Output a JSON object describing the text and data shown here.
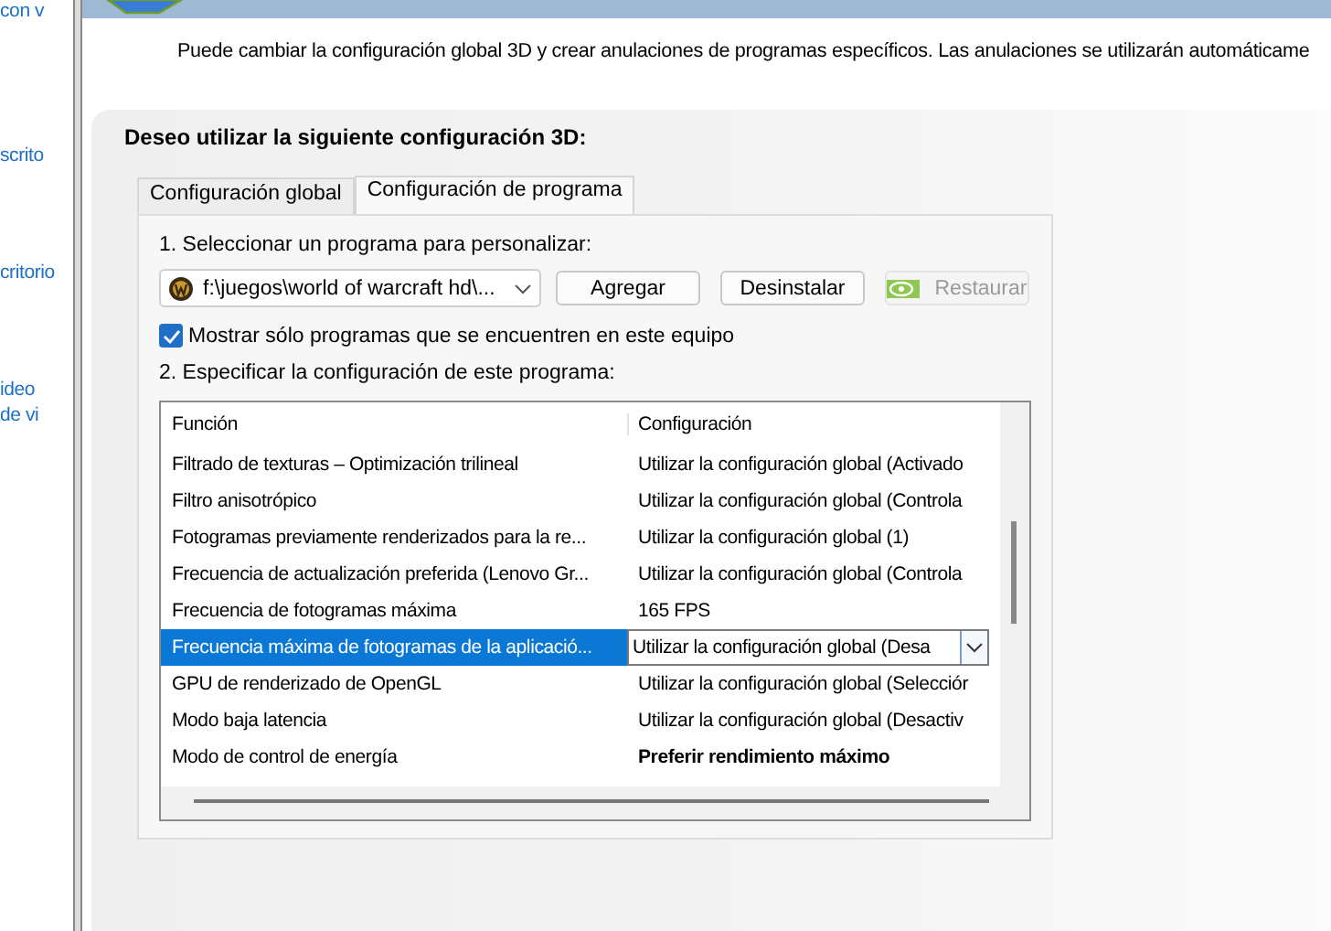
{
  "sidebar": {
    "items": [
      "con v",
      "scrito",
      "critorio",
      "ideo",
      "de vi"
    ]
  },
  "description": "Puede cambiar la configuración global 3D y crear anulaciones de programas específicos. Las anulaciones se utilizarán automáticame",
  "panel": {
    "title": "Deseo utilizar la siguiente configuración 3D:",
    "tabs": [
      {
        "label": "Configuración global",
        "selected": false
      },
      {
        "label": "Configuración de programa",
        "selected": true
      }
    ],
    "step1_label": "1. Seleccionar un programa para personalizar:",
    "program": {
      "value": "f:\\juegos\\world of warcraft hd\\..."
    },
    "buttons": [
      {
        "label": "Agregar",
        "disabled": false
      },
      {
        "label": "Desinstalar",
        "disabled": false
      },
      {
        "label": "Restaurar",
        "disabled": true
      }
    ],
    "show_only_installed": {
      "label": "Mostrar sólo programas que se encuentren en este equipo",
      "checked": true
    },
    "step2_label": "2. Especificar la configuración de este programa:",
    "table": {
      "columns": [
        "Función",
        "Configuración"
      ],
      "rows": [
        {
          "function": "Filtrado de texturas – Optimización trilineal",
          "setting": "Utilizar la configuración global (Activado",
          "selected": false,
          "bold": false
        },
        {
          "function": "Filtro anisotrópico",
          "setting": "Utilizar la configuración global (Controla",
          "selected": false,
          "bold": false
        },
        {
          "function": "Fotogramas previamente renderizados para la re...",
          "setting": "Utilizar la configuración global (1)",
          "selected": false,
          "bold": false
        },
        {
          "function": "Frecuencia de actualización preferida (Lenovo Gr...",
          "setting": "Utilizar la configuración global (Controla",
          "selected": false,
          "bold": false
        },
        {
          "function": "Frecuencia de fotogramas máxima",
          "setting": "165 FPS",
          "selected": false,
          "bold": false
        },
        {
          "function": "Frecuencia máxima de fotogramas de la aplicació...",
          "setting": "Utilizar la configuración global (Desa",
          "selected": true,
          "bold": false
        },
        {
          "function": "GPU de renderizado de OpenGL",
          "setting": "Utilizar la configuración global (Selecciór",
          "selected": false,
          "bold": false
        },
        {
          "function": "Modo baja latencia",
          "setting": "Utilizar la configuración global (Desactiv",
          "selected": false,
          "bold": false
        },
        {
          "function": "Modo de control de energía",
          "setting": "Preferir rendimiento máximo",
          "selected": false,
          "bold": true
        }
      ]
    }
  }
}
